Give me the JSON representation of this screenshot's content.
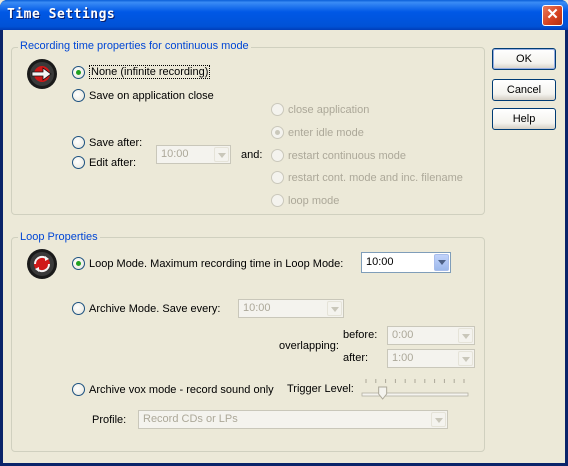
{
  "window": {
    "title": "Time Settings",
    "close_glyph": "✕"
  },
  "buttons": {
    "ok": "OK",
    "cancel": "Cancel",
    "help": "Help"
  },
  "recording": {
    "title": "Recording time properties for continuous mode",
    "none_label": "None (infinite recording)",
    "save_on_close_label": "Save on application close",
    "save_after_label": "Save after:",
    "edit_after_label": "Edit after:",
    "time_value": "10:00",
    "and_label": "and:",
    "actions": [
      "close application",
      "enter idle mode",
      "restart continuous mode",
      "restart cont. mode and inc. filename",
      "loop mode"
    ]
  },
  "loop": {
    "title": "Loop Properties",
    "loop_mode_label": "Loop Mode. Maximum recording time in Loop Mode:",
    "loop_time": "10:00",
    "archive_label": "Archive Mode. Save every:",
    "archive_time": "10:00",
    "overlapping_label": "overlapping:",
    "before_label": "before:",
    "before_value": "0:00",
    "after_label": "after:",
    "after_value": "1:00",
    "vox_label": "Archive vox mode - record sound only",
    "trigger_label": "Trigger Level:",
    "trigger_level": 0.17,
    "profile_label": "Profile:",
    "profile_value": "Record CDs or LPs"
  },
  "colors": {
    "title_bar": "#0058E6",
    "group_title": "#0046D5",
    "close": "#D4401E"
  }
}
